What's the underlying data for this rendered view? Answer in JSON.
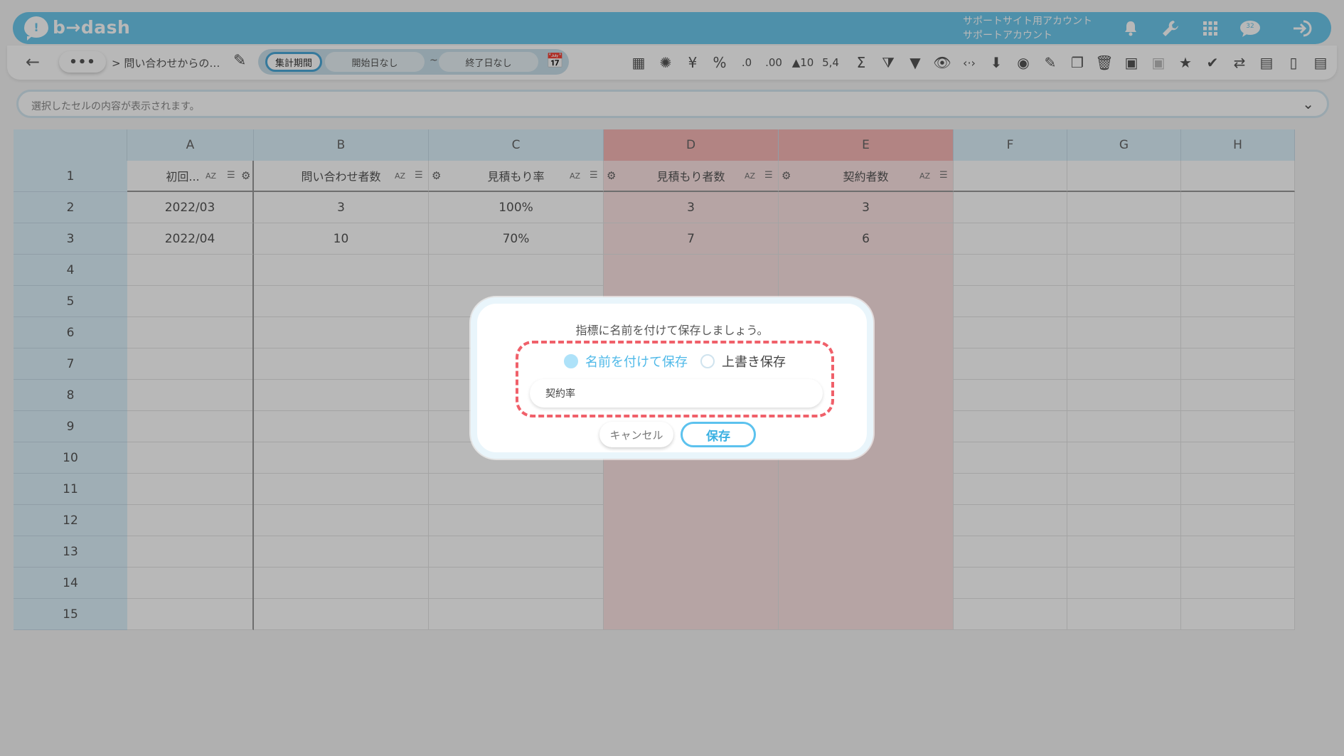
{
  "header": {
    "logo_text": "b→dash",
    "logo_glyph": "!",
    "account_line1": "サポートサイト用アカウント",
    "account_line2": "サポートアカウント",
    "icons": [
      "bell-icon",
      "wrench-icon",
      "grid-menu-icon",
      "chat-icon",
      "logout-icon"
    ],
    "brand_color": "#6cc8ec",
    "chat_badge": "32"
  },
  "toolbar": {
    "back": "←",
    "more": "•••",
    "breadcrumb": "> 問い合わせからの…",
    "period_label": "集計期間",
    "start_placeholder": "開始日なし",
    "tilde": "~",
    "end_placeholder": "終了日なし",
    "format_labels": {
      "yen": "¥",
      "percent": "%",
      "decimal_down": ".0",
      "decimal_up": ".00",
      "ten": "▲10",
      "comma": "5,4",
      "sigma": "Σ"
    }
  },
  "formula_bar": {
    "placeholder": "選択したセルの内容が表示されます。",
    "chevron": "⌄"
  },
  "grid": {
    "columns": [
      "A",
      "B",
      "C",
      "D",
      "E",
      "F",
      "G",
      "H"
    ],
    "selected_columns": [
      "D",
      "E"
    ],
    "rows": [
      "1",
      "2",
      "3",
      "4",
      "5",
      "6",
      "7",
      "8",
      "9",
      "10",
      "11",
      "12",
      "13",
      "14",
      "15"
    ],
    "header_row": [
      "初回...",
      "問い合わせ者数",
      "見積もり率",
      "見積もり者数",
      "契約者数"
    ],
    "az": "AZ",
    "data": [
      [
        "2022/03",
        "3",
        "100%",
        "3",
        "3"
      ],
      [
        "2022/04",
        "10",
        "70%",
        "7",
        "6"
      ]
    ],
    "selected_color": "#f7b8b6"
  },
  "dialog": {
    "title": "指標に名前を付けて保存しましょう。",
    "option_new": "名前を付けて保存",
    "option_overwrite": "上書き保存",
    "selected_option": "new",
    "name_value": "契約率",
    "cancel_label": "キャンセル",
    "save_label": "保存",
    "highlight_color": "#f0606a"
  }
}
